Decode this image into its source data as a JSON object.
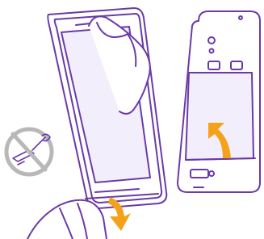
{
  "figure": {
    "colors": {
      "outline": "#6a3aa8",
      "screen_fill": "#f3eefb",
      "arrow": "#f5a21b",
      "prohibition": "#b8b8b8",
      "background": "#ffffff"
    },
    "icons": {
      "phone_front": "phone-front-icon",
      "phone_back": "phone-back-icon",
      "hand_top": "hand-icon",
      "hand_bottom": "hand-icon",
      "cover_lift_arrow": "curved-arrow-icon",
      "cover_remove_arrow": "curved-arrow-icon",
      "no_sharp_tool": "no-tool-icon"
    }
  }
}
